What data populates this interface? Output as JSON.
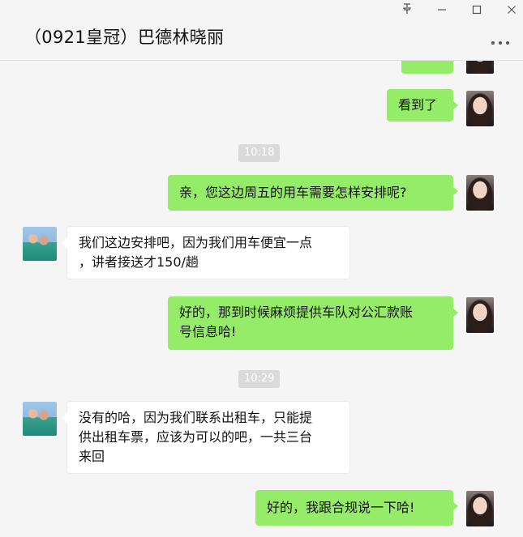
{
  "header": {
    "title": "（0921皇冠）巴德林晓丽",
    "pin_icon": "pin-icon",
    "minimize_icon": "minimize-icon",
    "maximize_icon": "maximize-icon",
    "close_icon": "close-icon",
    "more_icon": "more-icon"
  },
  "chat": {
    "msg_seen": "看到了",
    "time_1": "10:18",
    "msg_arrange": "亲，您这边周五的用车需要怎样安排呢?",
    "msg_reply_1_line1": "我们这边安排吧，因为我们用车便宜一点",
    "msg_reply_1_line2": "，讲者接送才150/趟",
    "msg_invoice_line1": "好的，那到时候麻烦提供车队对公汇款账",
    "msg_invoice_line2": "号信息哈!",
    "time_2": "10:29",
    "msg_reply_2_line1": "没有的哈，因为我们联系出租车，只能提",
    "msg_reply_2_line2": "供出租车票，应该为可以的吧，一共三台",
    "msg_reply_2_line3": "来回",
    "msg_confirm": "好的，我跟合规说一下哈!"
  },
  "colors": {
    "my_bubble": "#95ec69",
    "other_bubble": "#ffffff",
    "background": "#f5f5f5"
  }
}
